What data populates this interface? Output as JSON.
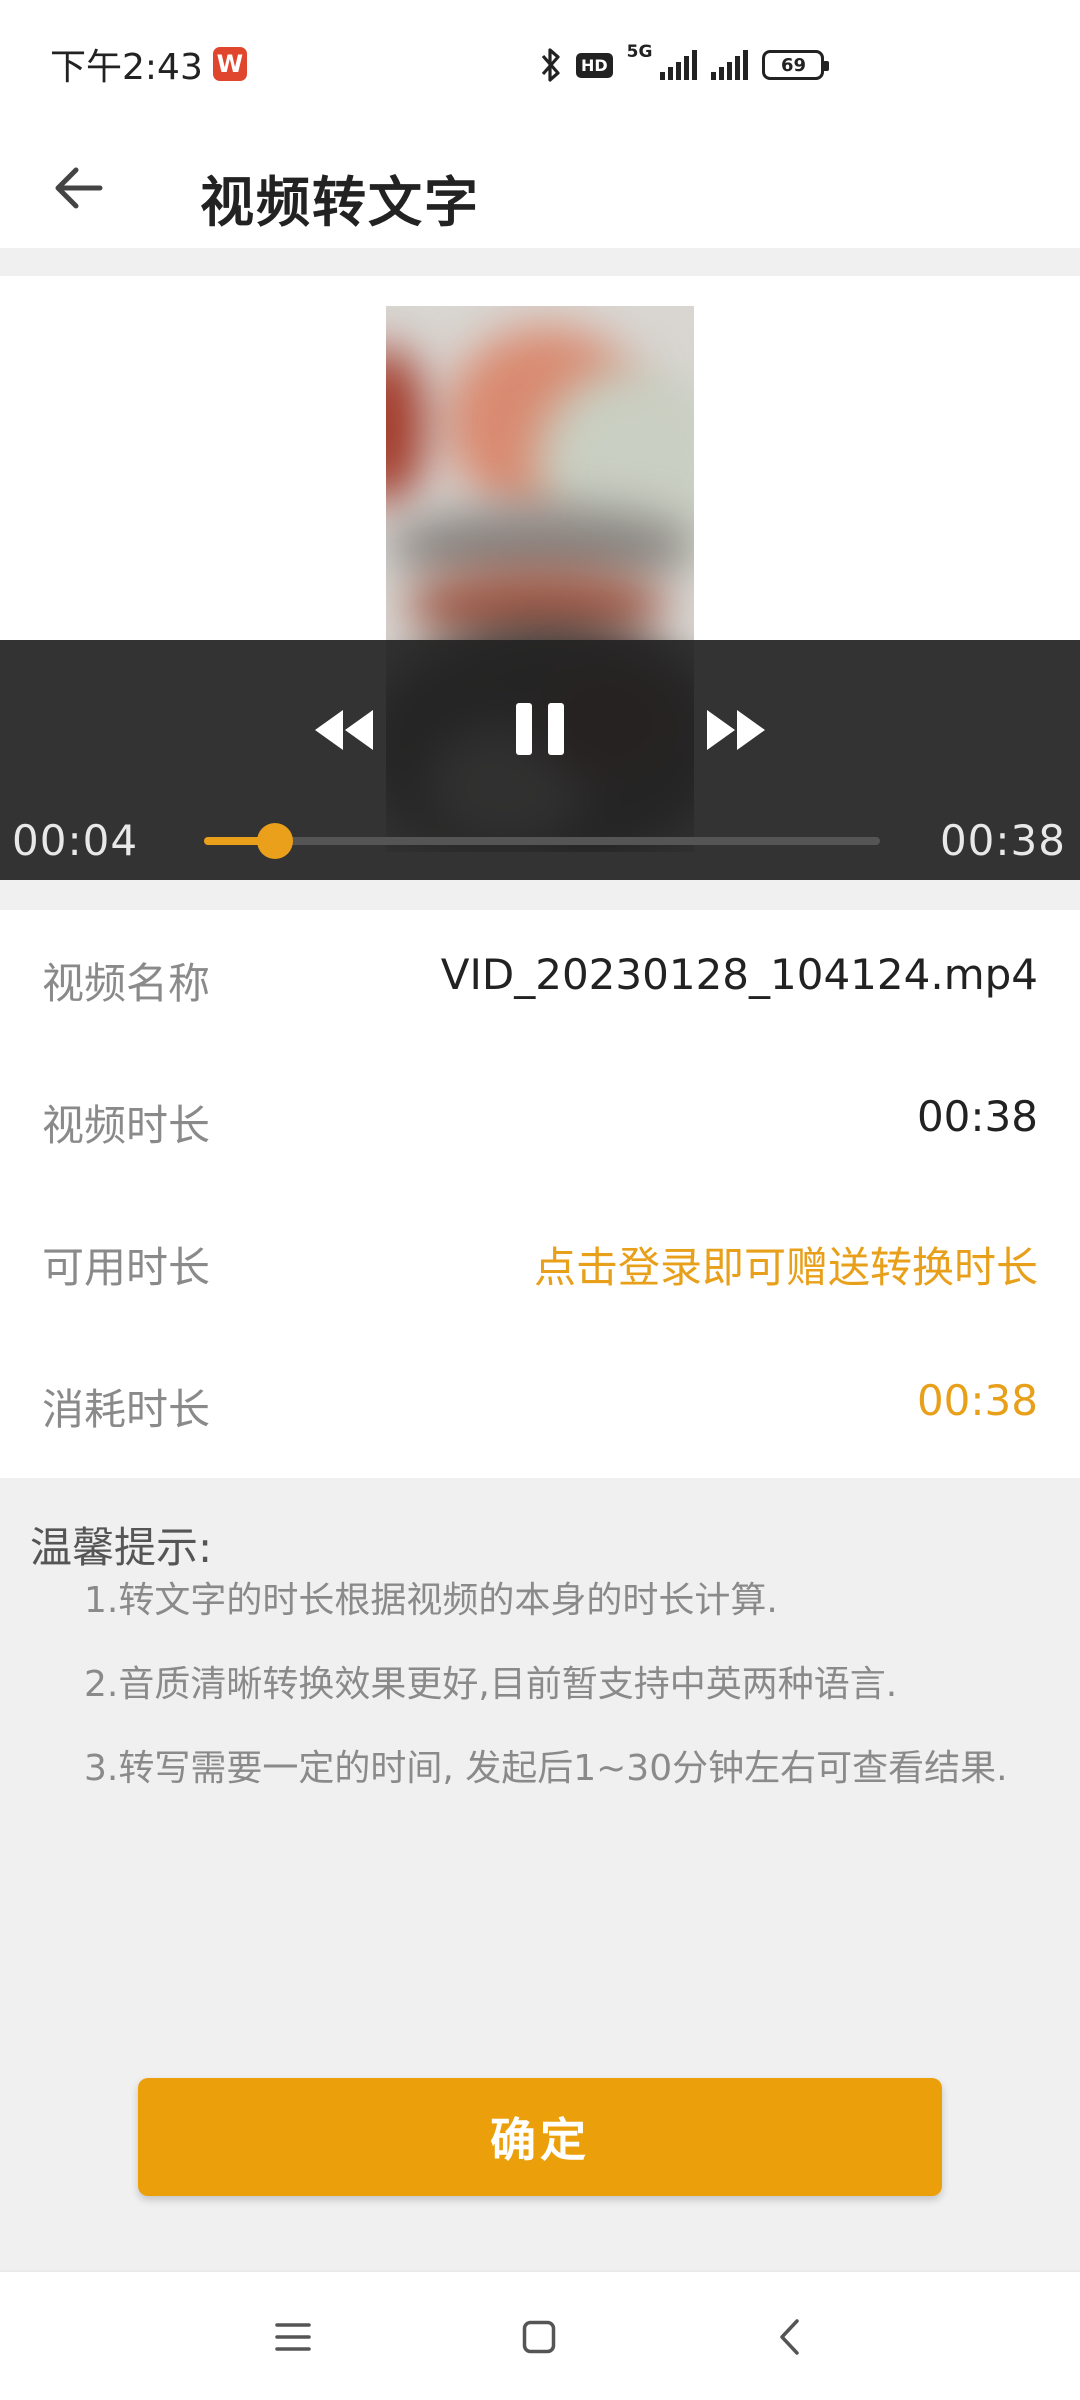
{
  "status_bar": {
    "time": "下午2:43",
    "app_badge": "W",
    "hd": "HD",
    "network": "5G",
    "battery": "69"
  },
  "header": {
    "title": "视频转文字"
  },
  "player": {
    "current_time": "00:04",
    "total_time": "00:38",
    "progress_fraction": 0.105
  },
  "info": {
    "rows": [
      {
        "label": "视频名称",
        "value": "VID_20230128_104124.mp4"
      },
      {
        "label": "视频时长",
        "value": "00:38"
      },
      {
        "label": "可用时长",
        "value": "点击登录即可赠送转换时长"
      },
      {
        "label": "消耗时长",
        "value": "00:38"
      }
    ]
  },
  "tips": {
    "title": "温馨提示:",
    "items": [
      "1.转文字的时长根据视频的本身的时长计算.",
      "2.音质清晰转换效果更好,目前暂支持中英两种语言.",
      "3.转写需要一定的时间, 发起后1~30分钟左右可查看结果."
    ]
  },
  "confirm_button": "确定",
  "colors": {
    "accent": "#eba00b",
    "controls_bg": "#232323",
    "page_gray": "#f0f0f0"
  },
  "icons": {
    "back": "arrow-left-icon",
    "rewind": "rewind-icon",
    "pause": "pause-icon",
    "fast_forward": "fast-forward-icon",
    "nav_menu": "menu-icon",
    "nav_home": "home-icon",
    "nav_back": "chevron-left-icon"
  }
}
